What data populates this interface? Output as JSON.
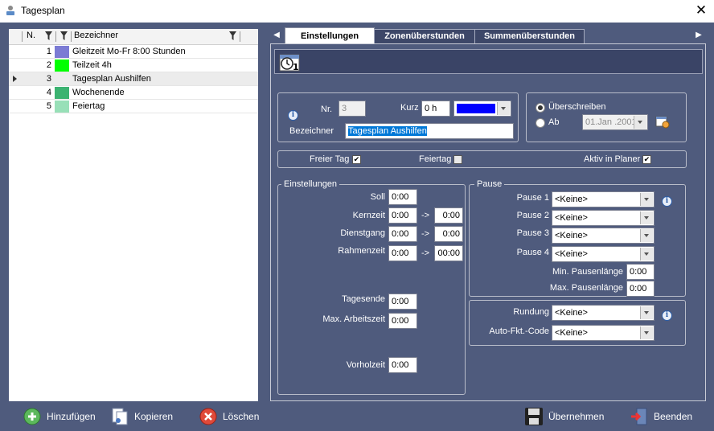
{
  "window": {
    "title": "Tagesplan"
  },
  "list": {
    "columns": {
      "nr": "N.",
      "name": "Bezeichner"
    },
    "rows": [
      {
        "nr": "1",
        "name": "Gleitzeit Mo-Fr 8:00 Stunden",
        "color": "#7b7bd4"
      },
      {
        "nr": "2",
        "name": "Teilzeit 4h",
        "color": "#00ff00"
      },
      {
        "nr": "3",
        "name": "Tagesplan Aushilfen",
        "color": "#ececec"
      },
      {
        "nr": "4",
        "name": "Wochenende",
        "color": "#3cb371"
      },
      {
        "nr": "5",
        "name": "Feiertag",
        "color": "#98e0b8"
      }
    ],
    "selected_index": 2
  },
  "bottom": {
    "add": "Hinzufügen",
    "copy": "Kopieren",
    "delete": "Löschen",
    "apply": "Übernehmen",
    "exit": "Beenden"
  },
  "tabs": [
    "Einstellungen",
    "Zonenüberstunden",
    "Summenüberstunden"
  ],
  "active_tab": 0,
  "form": {
    "nr_label": "Nr.",
    "nr_value": "3",
    "kurz_label": "Kurz",
    "kurz_value": "0 h",
    "color_value": "#0000ff",
    "bez_label": "Bezeichner",
    "bez_value": "Tagesplan Aushilfen",
    "overwrite_label": "Überschreiben",
    "ab_label": "Ab",
    "ab_date": "01.Jan .2001",
    "freier_tag": "Freier Tag",
    "feiertag": "Feiertag",
    "aktiv": "Aktiv in Planer",
    "freier_checked": true,
    "feiertag_checked": false,
    "aktiv_checked": true
  },
  "settings": {
    "title": "Einstellungen",
    "soll_label": "Soll",
    "soll": "0:00",
    "kern_label": "Kernzeit",
    "kern_from": "0:00",
    "kern_to": "0:00",
    "dienst_label": "Dienstgang",
    "dienst_from": "0:00",
    "dienst_to": "0:00",
    "rahmen_label": "Rahmenzeit",
    "rahmen_from": "0:00",
    "rahmen_to": "00:00",
    "arrow": "->",
    "tagesende_label": "Tagesende",
    "tagesende": "0:00",
    "maxarb_label": "Max. Arbeitszeit",
    "maxarb": "0:00",
    "vorhol_label": "Vorholzeit",
    "vorhol": "0:00"
  },
  "pause": {
    "title": "Pause",
    "p1_label": "Pause 1",
    "p1": "<Keine>",
    "p2_label": "Pause 2",
    "p2": "<Keine>",
    "p3_label": "Pause 3",
    "p3": "<Keine>",
    "p4_label": "Pause 4",
    "p4": "<Keine>",
    "min_label": "Min. Pausenlänge",
    "min": "0:00",
    "max_label": "Max. Pausenlänge",
    "max": "0:00"
  },
  "rounding": {
    "rund_label": "Rundung",
    "rund": "<Keine>",
    "auto_label": "Auto-Fkt.-Code",
    "auto": "<Keine>"
  },
  "colors": {
    "window_bg": "#4f5b7d",
    "accent_blue": "#0078d7"
  }
}
